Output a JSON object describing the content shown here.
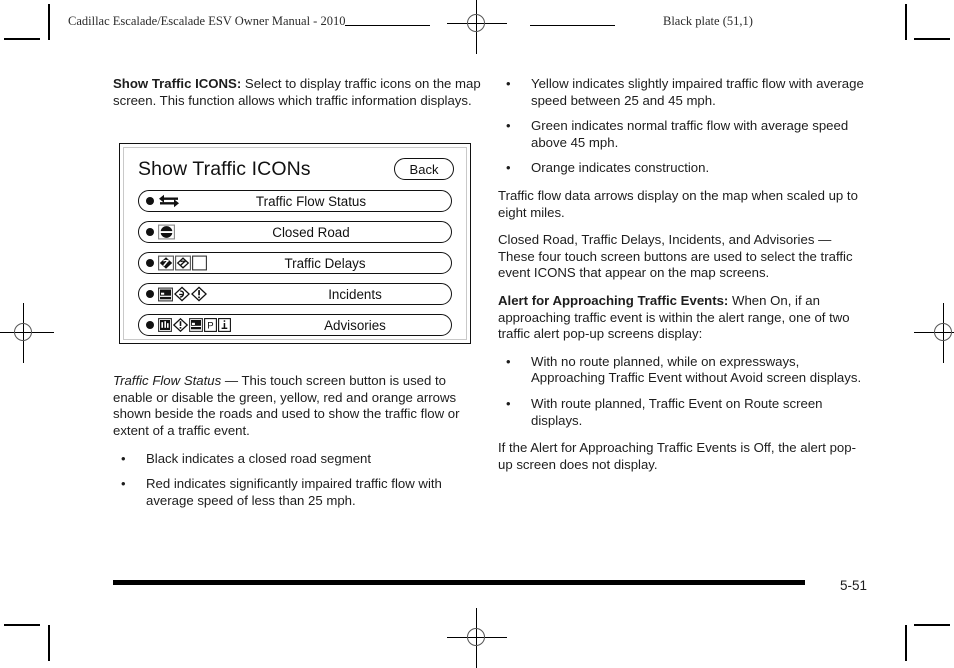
{
  "header": {
    "manual_title": "Cadillac Escalade/Escalade ESV Owner Manual - 2010",
    "plate": "Black plate (51,1)"
  },
  "left_column": {
    "intro": {
      "term": "Show Traffic ICONS:",
      "text": " Select to display traffic icons on the map screen. This function allows which traffic information displays."
    },
    "flow_status": {
      "term": "Traffic Flow Status",
      "text": " — This touch screen button is used to enable or disable the green, yellow, red and orange arrows shown beside the roads and used to show the traffic flow or extent of a traffic event."
    },
    "bullets": [
      "Black indicates a closed road segment",
      "Red indicates significantly impaired traffic flow with average speed of less than 25 mph."
    ]
  },
  "figure": {
    "title": "Show Traffic ICONs",
    "back_label": "Back",
    "rows": [
      {
        "label": "Traffic Flow Status",
        "icons": [
          "traffic-flow-arrows-icon"
        ]
      },
      {
        "label": "Closed Road",
        "icons": [
          "closed-road-icon"
        ]
      },
      {
        "label": "Traffic Delays",
        "icons": [
          "delay-diamond-icon",
          "delay-diamond-outline-icon",
          "blank-square-icon"
        ]
      },
      {
        "label": "Incidents",
        "icons": [
          "incident-accident-icon",
          "incident-diamond-icon",
          "incident-exclamation-icon"
        ]
      },
      {
        "label": "Advisories",
        "icons": [
          "advisory-info-icon",
          "advisory-diamond-icon",
          "advisory-scene-icon",
          "advisory-parking-icon",
          "advisory-information-icon"
        ]
      }
    ]
  },
  "right_column": {
    "bullets_top": [
      "Yellow indicates slightly impaired traffic flow with average speed between 25 and 45 mph.",
      "Green indicates normal traffic flow with average speed above 45 mph.",
      "Orange indicates construction."
    ],
    "para_arrows": "Traffic flow data arrows display on the map when scaled up to eight miles.",
    "para_buttons": "Closed Road, Traffic Delays, Incidents, and Advisories — These four touch screen buttons are used to select the traffic event ICONS that appear on the map screens.",
    "alert": {
      "term": "Alert for Approaching Traffic Events:",
      "text": " When On, if an approaching traffic event is within the alert range, one of two traffic alert pop-up screens display:"
    },
    "bullets_bottom": [
      "With no route planned, while on expressways, Approaching Traffic Event without Avoid screen displays.",
      "With route planned, Traffic Event on Route screen displays."
    ],
    "para_off": "If the Alert for Approaching Traffic Events is Off, the alert pop-up screen does not display."
  },
  "footer": {
    "page_number": "5-51"
  },
  "glyphs": {
    "bullet": "•"
  }
}
